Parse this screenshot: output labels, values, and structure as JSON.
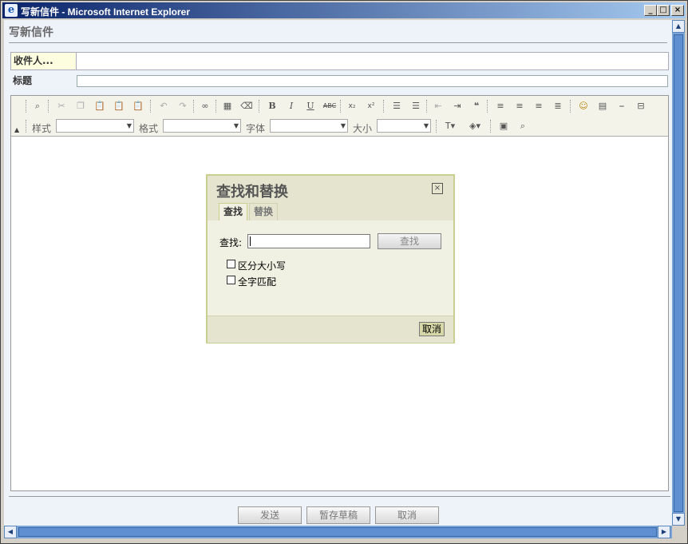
{
  "window": {
    "title": "写新信件 - Microsoft Internet Explorer",
    "minimize_glyph": "_",
    "maximize_glyph": "□",
    "close_glyph": "×"
  },
  "page": {
    "heading": "写新信件",
    "recipient_label": "收件人...",
    "subject_label": "标题",
    "recipient_value": "",
    "subject_value": ""
  },
  "toolbar": {
    "style_label": "样式",
    "format_label": "格式",
    "font_label": "字体",
    "size_label": "大小",
    "style_value": "",
    "format_value": "",
    "font_value": "",
    "size_value": "",
    "bold_glyph": "B",
    "italic_glyph": "I",
    "underline_glyph": "U",
    "strike_glyph": "ABC",
    "subscript_glyph": "x₂",
    "superscript_glyph": "x²"
  },
  "dialog": {
    "title": "查找和替换",
    "tabs": [
      {
        "label": "查找",
        "active": true
      },
      {
        "label": "替换",
        "active": false
      }
    ],
    "find_label": "查找:",
    "find_value": "",
    "find_button": "查找",
    "match_case_label": "区分大小写",
    "match_case_checked": false,
    "whole_word_label": "全字匹配",
    "whole_word_checked": false,
    "cancel_button": "取消"
  },
  "actions": {
    "send": "发送",
    "save_draft": "暂存草稿",
    "cancel": "取消"
  },
  "colors": {
    "titlebar_start": "#0a246a",
    "titlebar_end": "#a6caf0",
    "dialog_bg": "#f1f1e3",
    "dialog_header": "#e4e4cf",
    "dialog_border": "#c8cf8f",
    "recipient_bg": "#fdfde0",
    "scrollbar": "#7aa3d6"
  }
}
